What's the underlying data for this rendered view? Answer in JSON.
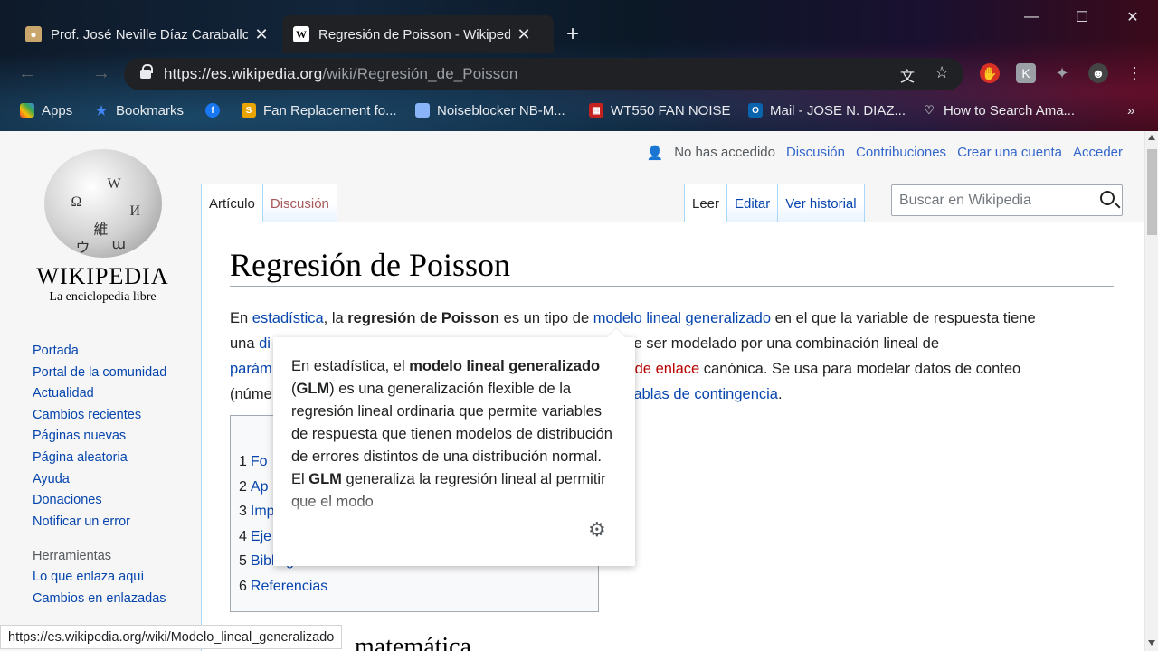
{
  "browser": {
    "tabs": [
      {
        "title": "Prof. José Neville Díaz Caraballo",
        "close": "✕"
      },
      {
        "title": "Regresión de Poisson - Wikipedia",
        "close": "✕"
      }
    ],
    "new_tab": "+",
    "window_controls": {
      "minimize": "—",
      "maximize": "☐",
      "close": "✕"
    },
    "url_host": "https://es.wikipedia.org",
    "url_path": "/wiki/Regresión_de_Poisson",
    "bookmarks": [
      {
        "label": "Apps",
        "icon": "apps-grid-icon"
      },
      {
        "label": "Bookmarks",
        "icon": "bookmark-star-icon"
      },
      {
        "label": "",
        "icon": "facebook-icon"
      },
      {
        "label": "Fan Replacement fo...",
        "icon": "fan-icon"
      },
      {
        "label": "Noiseblocker NB-M...",
        "icon": "note-icon"
      },
      {
        "label": "WT550 FAN NOISE",
        "icon": "calendar-icon"
      },
      {
        "label": "Mail - JOSE N. DIAZ...",
        "icon": "outlook-icon"
      },
      {
        "label": "How to Search Ama...",
        "icon": "heart-icon"
      }
    ],
    "bookmarks_more": "»"
  },
  "wiki": {
    "user_menu": {
      "not_logged": "No has accedido",
      "links": [
        "Discusión",
        "Contribuciones",
        "Crear una cuenta",
        "Acceder"
      ]
    },
    "wordmark": "Wikipedia",
    "tagline": "La enciclopedia libre",
    "nav": [
      "Portada",
      "Portal de la comunidad",
      "Actualidad",
      "Cambios recientes",
      "Páginas nuevas",
      "Página aleatoria",
      "Ayuda",
      "Donaciones",
      "Notificar un error"
    ],
    "tools_header": "Herramientas",
    "tools": [
      "Lo que enlaza aquí",
      "Cambios en enlazadas"
    ],
    "tabs_left": [
      "Artículo",
      "Discusión"
    ],
    "tabs_right": [
      "Leer",
      "Editar",
      "Ver historial"
    ],
    "search_placeholder": "Buscar en Wikipedia",
    "title": "Regresión de Poisson",
    "lead": {
      "l1a": "En ",
      "l1b": "estadística",
      ", ": "",
      "l1c": ", la ",
      "l1d": "regresión de Poisson",
      "l1e": " es un tipo de ",
      "l1f": "modelo lineal generalizado",
      "l1g": " en el que la variable de respuesta tiene",
      "l2a": "una ",
      "l2b": "di",
      "l2c": "erado puede ser modelado por una combinación lineal de",
      "l3a": "parám",
      "l3b": "sión de enlace",
      "l3c": " canónica. Se usa para modelar datos de conteo",
      "l4a": "(núme",
      "l4b": "tablas de contingencia",
      "l4c": "."
    },
    "toc": [
      {
        "n": "1",
        "t": "Fo"
      },
      {
        "n": "2",
        "t": "Ap"
      },
      {
        "n": "3",
        "t": "Imp"
      },
      {
        "n": "4",
        "t": "Eje"
      },
      {
        "n": "5",
        "t": "Bibliografía"
      },
      {
        "n": "6",
        "t": "Referencias"
      }
    ],
    "h2_partial": "matemática",
    "popup": {
      "p1": "En estadística, el ",
      "b1": "modelo lineal generalizado",
      "p2": " (",
      "b2": "GLM",
      "p3": ") es una generalización flexible de la regresión lineal ordinaria que permite variables de respuesta que tienen modelos de distribución de errores distintos de una distribución normal. El ",
      "b3": "GLM",
      "p4": " generaliza la regresión lineal al permitir que el modo"
    },
    "status_url": "https://es.wikipedia.org/wiki/Modelo_lineal_generalizado"
  }
}
